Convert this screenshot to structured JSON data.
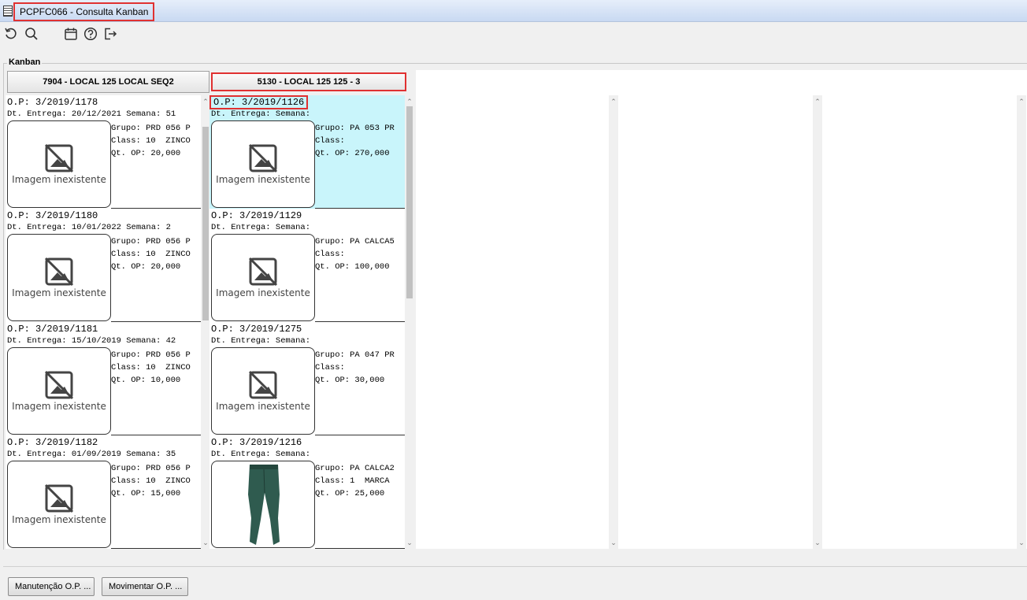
{
  "window": {
    "title": "PCPFC066 - Consulta Kanban"
  },
  "toolbar": {
    "buttons": [
      {
        "name": "refresh-icon"
      },
      {
        "name": "search-icon"
      },
      {
        "name": "calendar-icon"
      },
      {
        "name": "help-icon"
      },
      {
        "name": "exit-icon"
      }
    ]
  },
  "group": {
    "label": "Kanban"
  },
  "columns": [
    {
      "header": "7904 - LOCAL 125 LOCAL SEQ2",
      "cards": [
        {
          "op": "O.P: 3/2019/1178",
          "dt": "Dt. Entrega: 20/12/2021 Semana: 51",
          "grupo": "Grupo: PRD 056 P",
          "class": "Class: 10  ZINCO",
          "qt": "Qt. OP: 20,000",
          "image": "Imagem inexistente"
        },
        {
          "op": "O.P: 3/2019/1180",
          "dt": "Dt. Entrega: 10/01/2022 Semana: 2",
          "grupo": "Grupo: PRD 056 P",
          "class": "Class: 10  ZINCO",
          "qt": "Qt. OP: 20,000",
          "image": "Imagem inexistente"
        },
        {
          "op": "O.P: 3/2019/1181",
          "dt": "Dt. Entrega: 15/10/2019 Semana: 42",
          "grupo": "Grupo: PRD 056 P",
          "class": "Class: 10  ZINCO",
          "qt": "Qt. OP: 10,000",
          "image": "Imagem inexistente"
        },
        {
          "op": "O.P: 3/2019/1182",
          "dt": "Dt. Entrega: 01/09/2019 Semana: 35",
          "grupo": "Grupo: PRD 056 P",
          "class": "Class: 10  ZINCO",
          "qt": "Qt. OP: 15,000",
          "image": "Imagem inexistente"
        }
      ]
    },
    {
      "header": "5130 - LOCAL 125 125 - 3",
      "cards": [
        {
          "op": "O.P: 3/2019/1126",
          "dt": "Dt. Entrega:  Semana:",
          "grupo": "Grupo: PA 053 PR",
          "class": "Class:",
          "qt": "Qt. OP: 270,000",
          "image": "Imagem inexistente"
        },
        {
          "op": "O.P: 3/2019/1129",
          "dt": "Dt. Entrega:  Semana:",
          "grupo": "Grupo: PA CALCA5",
          "class": "Class:",
          "qt": "Qt. OP: 100,000",
          "image": "Imagem inexistente"
        },
        {
          "op": "O.P: 3/2019/1275",
          "dt": "Dt. Entrega:  Semana:",
          "grupo": "Grupo: PA 047 PR",
          "class": "Class:",
          "qt": "Qt. OP: 30,000",
          "image": "Imagem inexistente"
        },
        {
          "op": "O.P: 3/2019/1216",
          "dt": "Dt. Entrega:  Semana:",
          "grupo": "Grupo: PA CALCA2",
          "class": "Class: 1  MARCA",
          "qt": "Qt. OP: 25,000",
          "image": ""
        }
      ]
    }
  ],
  "buttons": {
    "manutencao": "Manutenção O.P. ...",
    "movimentar": "Movimentar O.P. ..."
  },
  "colors": {
    "highlight": "#c9f5fb",
    "annotation": "#e03131",
    "pants": "#2f5b4f"
  }
}
